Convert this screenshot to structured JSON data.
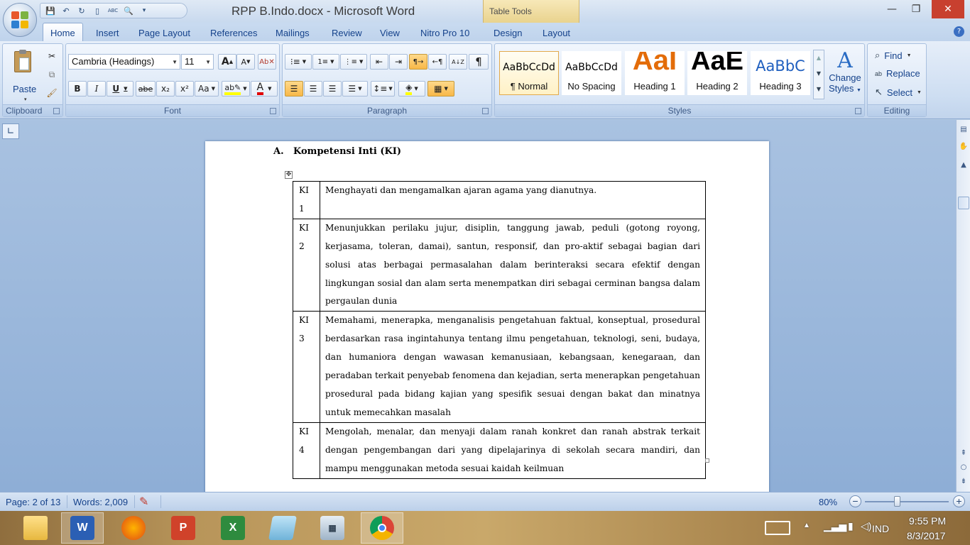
{
  "window": {
    "title": "RPP B.Indo.docx - Microsoft Word",
    "contextual_tab_group": "Table Tools",
    "controls": {
      "minimize": "—",
      "maximize": "❐",
      "close": "✕"
    }
  },
  "ribbon_tabs": [
    "Home",
    "Insert",
    "Page Layout",
    "References",
    "Mailings",
    "Review",
    "View",
    "Nitro Pro 10",
    "Design",
    "Layout"
  ],
  "active_tab": "Home",
  "clipboard": {
    "paste_label": "Paste",
    "group_label": "Clipboard"
  },
  "font": {
    "family": "Cambria (Headings)",
    "size": "11",
    "group_label": "Font",
    "bold": "B",
    "italic": "I",
    "underline": "U",
    "strike": "abe",
    "subscript": "x₂",
    "superscript": "x²",
    "change_case": "Aa",
    "grow": "A",
    "shrink": "A",
    "font_color": "#e00000",
    "highlight_color": "#ffff00"
  },
  "paragraph": {
    "group_label": "Paragraph",
    "show_marks": "¶",
    "sort": "A↓Z"
  },
  "styles": {
    "group_label": "Styles",
    "items": [
      {
        "preview": "AaBbCcDd",
        "name": "¶ Normal"
      },
      {
        "preview": "AaBbCcDd",
        "name": "No Spacing"
      },
      {
        "preview": "AaI",
        "name": "Heading 1"
      },
      {
        "preview": "AaE",
        "name": "Heading 2"
      },
      {
        "preview": "AaBbC",
        "name": "Heading 3"
      }
    ],
    "change_styles_line1": "Change",
    "change_styles_line2": "Styles"
  },
  "editing": {
    "find": "Find",
    "replace": "Replace",
    "select": "Select",
    "group_label": "Editing"
  },
  "document": {
    "heading_number": "A.",
    "heading_text": "Kompetensi Inti (KI)",
    "table": [
      {
        "code": "KI\n1",
        "text": "Menghayati dan mengamalkan ajaran agama yang dianutnya."
      },
      {
        "code": "KI\n2",
        "text": "Menunjukkan perilaku jujur, disiplin, tanggung jawab, peduli (gotong royong, kerjasama, toleran, damai), santun, responsif, dan pro-aktif sebagai bagian dari solusi atas berbagai permasalahan dalam berinteraksi secara efektif dengan lingkungan sosial dan alam serta menempatkan diri sebagai cerminan bangsa dalam pergaulan dunia"
      },
      {
        "code": "KI\n3",
        "text": "Memahami, menerapka, menganalisis pengetahuan faktual, konseptual, prosedural berdasarkan rasa ingintahunya tentang ilmu pengetahuan, teknologi, seni, budaya, dan humaniora dengan wawasan kemanusiaan, kebangsaan, kenegaraan, dan peradaban terkait penyebab fenomena dan kejadian, serta menerapkan pengetahuan prosedural pada bidang kajian yang spesifik sesuai dengan bakat dan minatnya untuk memecahkan masalah"
      },
      {
        "code": "KI\n4",
        "text": "Mengolah, menalar, dan menyaji dalam ranah konkret dan ranah abstrak terkait dengan pengembangan dari yang dipelajarinya di sekolah secara mandiri, dan mampu menggunakan metoda sesuai kaidah keilmuan"
      }
    ]
  },
  "statusbar": {
    "page": "Page: 2 of 13",
    "words": "Words: 2,009",
    "zoom": "80%",
    "zoom_level_percent": 80
  },
  "taskbar": {
    "apps": [
      "file-explorer",
      "word",
      "firefox",
      "powerpoint",
      "excel",
      "notepad",
      "calculator",
      "chrome"
    ],
    "language": "IND",
    "time": "9:55 PM",
    "date": "8/3/2017"
  }
}
